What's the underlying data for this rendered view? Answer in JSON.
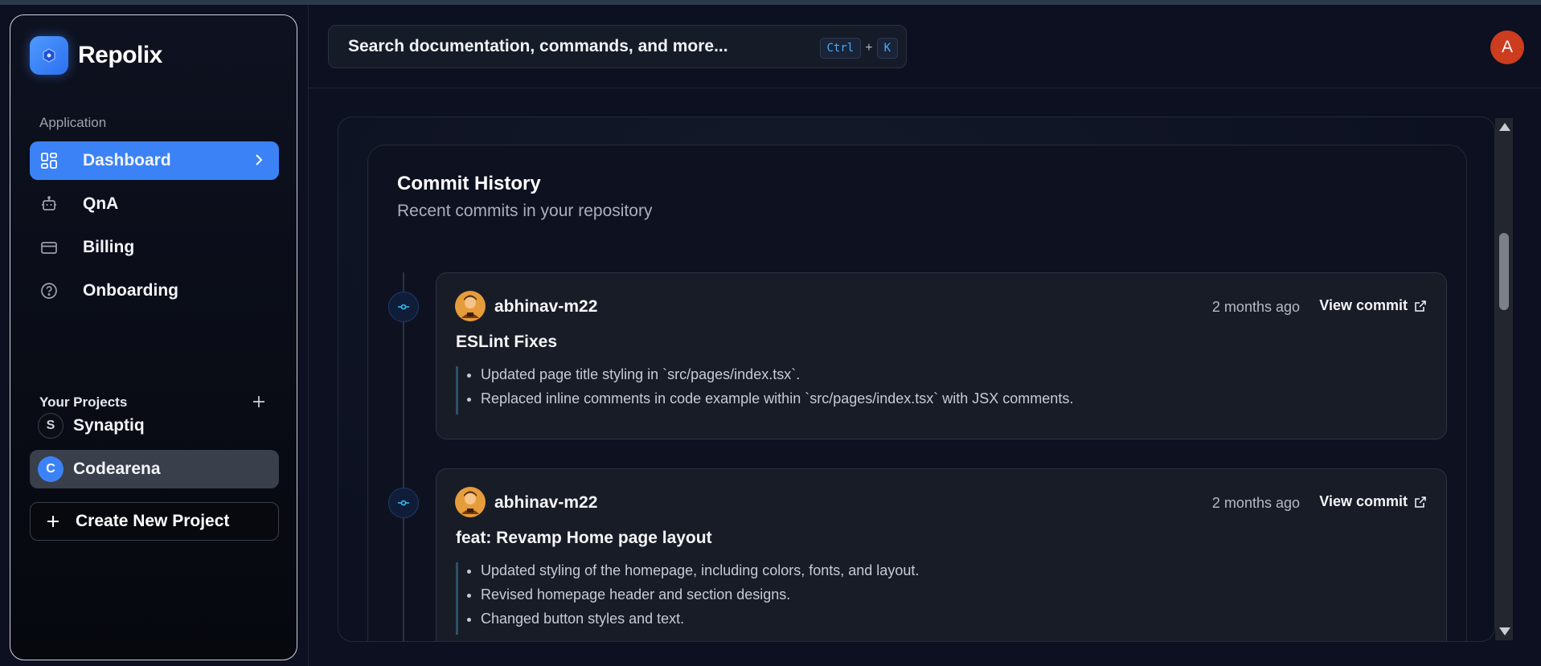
{
  "app": {
    "name": "Repolix"
  },
  "sidebar": {
    "section_label": "Application",
    "nav": [
      {
        "label": "Dashboard",
        "icon": "dashboard-icon",
        "active": true
      },
      {
        "label": "QnA",
        "icon": "bot-icon"
      },
      {
        "label": "Billing",
        "icon": "credit-card-icon"
      },
      {
        "label": "Onboarding",
        "icon": "help-circle-icon"
      }
    ],
    "projects_label": "Your Projects",
    "projects": [
      {
        "initial": "S",
        "name": "Synaptiq",
        "selected": false
      },
      {
        "initial": "C",
        "name": "Codearena",
        "selected": true
      }
    ],
    "create_label": "Create New Project"
  },
  "header": {
    "search_placeholder": "Search documentation, commands, and more...",
    "shortcut": [
      "Ctrl",
      "K"
    ],
    "shortcut_plus": "+",
    "avatar_initial": "A"
  },
  "commit_history": {
    "title": "Commit History",
    "subtitle": "Recent commits in your repository",
    "commits": [
      {
        "author": "abhinav-m22",
        "time": "2 months ago",
        "view_label": "View commit",
        "message": "ESLint Fixes",
        "notes": [
          "Updated page title styling in `src/pages/index.tsx`.",
          "Replaced inline comments in code example within `src/pages/index.tsx` with JSX comments."
        ]
      },
      {
        "author": "abhinav-m22",
        "time": "2 months ago",
        "view_label": "View commit",
        "message": "feat: Revamp Home page layout",
        "notes": [
          "Updated styling of the homepage, including colors, fonts, and layout.",
          "Revised homepage header and section designs.",
          "Changed button styles and text."
        ]
      }
    ]
  },
  "colors": {
    "accent": "#3b82f6",
    "avatar": "#cc3c1f",
    "background": "#0c1020",
    "timeline_dot": "#38bdf8"
  }
}
